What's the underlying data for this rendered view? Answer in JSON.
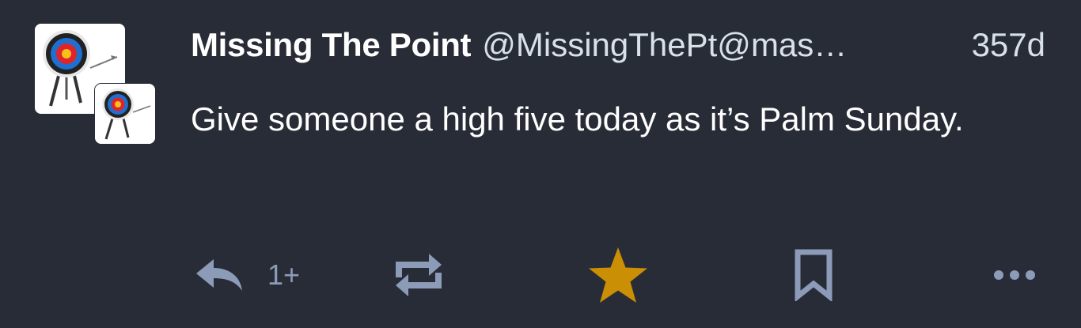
{
  "status": {
    "display_name": "Missing The Point",
    "acct": "@MissingThePt@mas",
    "ellipsis": "…",
    "timestamp": "357d",
    "content": "Give someone a high five today as it’s Palm Sunday.",
    "reply_count": "1+"
  },
  "icons": {
    "avatar_main": "archery-target-avatar",
    "avatar_sub": "archery-target-boosted-avatar",
    "reply": "reply-icon",
    "boost": "boost-icon",
    "favourite": "star-icon",
    "bookmark": "bookmark-icon",
    "more": "ellipsis-icon"
  },
  "colors": {
    "background": "#282c37",
    "text": "#ffffff",
    "secondary_text": "#d9e1e8",
    "action_icon": "#8c9bb8",
    "favourited_star": "#ca8f04"
  },
  "state": {
    "favourited": true
  }
}
